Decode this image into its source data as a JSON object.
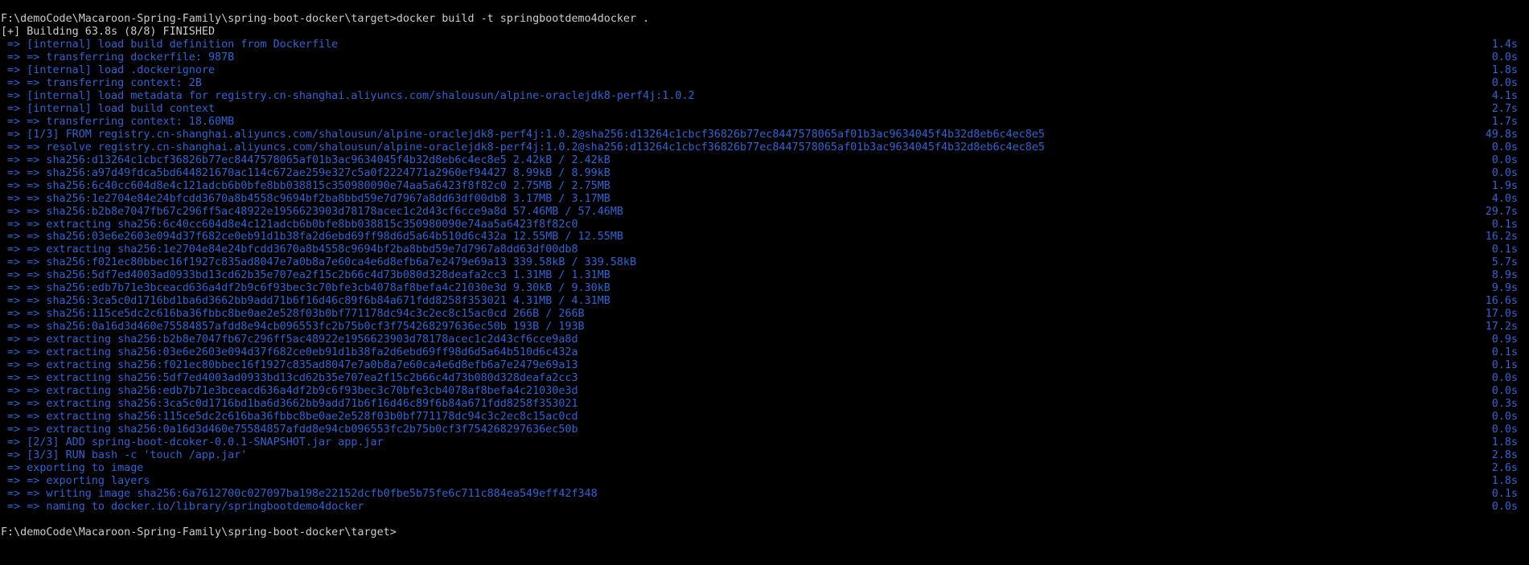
{
  "colors": {
    "background": "#000000",
    "text": "#cccccc",
    "build_output": "#2f64d6"
  },
  "terminal": {
    "command_line": "F:\\demoCode\\Macaroon-Spring-Family\\spring-boot-docker\\target>docker build -t springbootdemo4docker .",
    "header": "[+] Building 63.8s (8/8) FINISHED",
    "lines": [
      {
        "text": " => [internal] load build definition from Dockerfile",
        "time": "1.4s"
      },
      {
        "text": " => => transferring dockerfile: 987B",
        "time": "0.0s"
      },
      {
        "text": " => [internal] load .dockerignore",
        "time": "1.8s"
      },
      {
        "text": " => => transferring context: 2B",
        "time": "0.0s"
      },
      {
        "text": " => [internal] load metadata for registry.cn-shanghai.aliyuncs.com/shalousun/alpine-oraclejdk8-perf4j:1.0.2",
        "time": "4.1s"
      },
      {
        "text": " => [internal] load build context",
        "time": "2.7s"
      },
      {
        "text": " => => transferring context: 18.60MB",
        "time": "1.7s"
      },
      {
        "text": " => [1/3] FROM registry.cn-shanghai.aliyuncs.com/shalousun/alpine-oraclejdk8-perf4j:1.0.2@sha256:d13264c1cbcf36826b77ec8447578065af01b3ac9634045f4b32d8eb6c4ec8e5",
        "time": "49.8s"
      },
      {
        "text": " => => resolve registry.cn-shanghai.aliyuncs.com/shalousun/alpine-oraclejdk8-perf4j:1.0.2@sha256:d13264c1cbcf36826b77ec8447578065af01b3ac9634045f4b32d8eb6c4ec8e5",
        "time": "0.0s"
      },
      {
        "text": " => => sha256:d13264c1cbcf36826b77ec8447578065af01b3ac9634045f4b32d8eb6c4ec8e5 2.42kB / 2.42kB",
        "time": "0.0s"
      },
      {
        "text": " => => sha256:a97d49fdca5bd644821670ac114c672ae259e327c5a0f2224771a2960ef94427 8.99kB / 8.99kB",
        "time": "0.0s"
      },
      {
        "text": " => => sha256:6c40cc604d8e4c121adcb6b0bfe8bb038815c350980090e74aa5a6423f8f82c0 2.75MB / 2.75MB",
        "time": "1.9s"
      },
      {
        "text": " => => sha256:1e2704e84e24bfcdd3670a8b4558c9694bf2ba8bbd59e7d7967a8dd63df00db8 3.17MB / 3.17MB",
        "time": "4.0s"
      },
      {
        "text": " => => sha256:b2b8e7047fb67c296ff5ac48922e1956623903d78178acec1c2d43cf6cce9a8d 57.46MB / 57.46MB",
        "time": "29.7s"
      },
      {
        "text": " => => extracting sha256:6c40cc604d8e4c121adcb6b0bfe8bb038815c350980090e74aa5a6423f8f82c0",
        "time": "0.1s"
      },
      {
        "text": " => => sha256:03e6e2603e094d37f682ce0eb91d1b38fa2d6ebd69ff98d6d5a64b510d6c432a 12.55MB / 12.55MB",
        "time": "16.2s"
      },
      {
        "text": " => => extracting sha256:1e2704e84e24bfcdd3670a8b4558c9694bf2ba8bbd59e7d7967a8dd63df00db8",
        "time": "0.1s"
      },
      {
        "text": " => => sha256:f021ec80bbec16f1927c835ad8047e7a0b8a7e60ca4e6d8efb6a7e2479e69a13 339.58kB / 339.58kB",
        "time": "5.7s"
      },
      {
        "text": " => => sha256:5df7ed4003ad0933bd13cd62b35e707ea2f15c2b66c4d73b080d328deafa2cc3 1.31MB / 1.31MB",
        "time": "8.9s"
      },
      {
        "text": " => => sha256:edb7b71e3bceacd636a4df2b9c6f93bec3c70bfe3cb4078af8befa4c21030e3d 9.30kB / 9.30kB",
        "time": "9.9s"
      },
      {
        "text": " => => sha256:3ca5c0d1716bd1ba6d3662bb9add71b6f16d46c89f6b84a671fdd8258f353021 4.31MB / 4.31MB",
        "time": "16.6s"
      },
      {
        "text": " => => sha256:115ce5dc2c616ba36fbbc8be0ae2e528f03b0bf771178dc94c3c2ec8c15ac0cd 266B / 266B",
        "time": "17.0s"
      },
      {
        "text": " => => sha256:0a16d3d460e75584857afdd8e94cb096553fc2b75b0cf3f754268297636ec50b 193B / 193B",
        "time": "17.2s"
      },
      {
        "text": " => => extracting sha256:b2b8e7047fb67c296ff5ac48922e1956623903d78178acec1c2d43cf6cce9a8d",
        "time": "0.9s"
      },
      {
        "text": " => => extracting sha256:03e6e2603e094d37f682ce0eb91d1b38fa2d6ebd69ff98d6d5a64b510d6c432a",
        "time": "0.1s"
      },
      {
        "text": " => => extracting sha256:f021ec80bbec16f1927c835ad8047e7a0b8a7e60ca4e6d8efb6a7e2479e69a13",
        "time": "0.1s"
      },
      {
        "text": " => => extracting sha256:5df7ed4003ad0933bd13cd62b35e707ea2f15c2b66c4d73b080d328deafa2cc3",
        "time": "0.0s"
      },
      {
        "text": " => => extracting sha256:edb7b71e3bceacd636a4df2b9c6f93bec3c70bfe3cb4078af8befa4c21030e3d",
        "time": "0.0s"
      },
      {
        "text": " => => extracting sha256:3ca5c0d1716bd1ba6d3662bb9add71b6f16d46c89f6b84a671fdd8258f353021",
        "time": "0.3s"
      },
      {
        "text": " => => extracting sha256:115ce5dc2c616ba36fbbc8be0ae2e528f03b0bf771178dc94c3c2ec8c15ac0cd",
        "time": "0.0s"
      },
      {
        "text": " => => extracting sha256:0a16d3d460e75584857afdd8e94cb096553fc2b75b0cf3f754268297636ec50b",
        "time": "0.0s"
      },
      {
        "text": " => [2/3] ADD spring-boot-dcoker-0.0.1-SNAPSHOT.jar app.jar",
        "time": "1.8s"
      },
      {
        "text": " => [3/3] RUN bash -c 'touch /app.jar'",
        "time": "2.8s"
      },
      {
        "text": " => exporting to image",
        "time": "2.6s"
      },
      {
        "text": " => => exporting layers",
        "time": "1.8s"
      },
      {
        "text": " => => writing image sha256:6a7612700c027097ba198e22152dcfb0fbe5b75fe6c711c884ea549eff42f348",
        "time": "0.1s"
      },
      {
        "text": " => => naming to docker.io/library/springbootdemo4docker",
        "time": "0.0s"
      }
    ],
    "final_prompt": "F:\\demoCode\\Macaroon-Spring-Family\\spring-boot-docker\\target>"
  }
}
